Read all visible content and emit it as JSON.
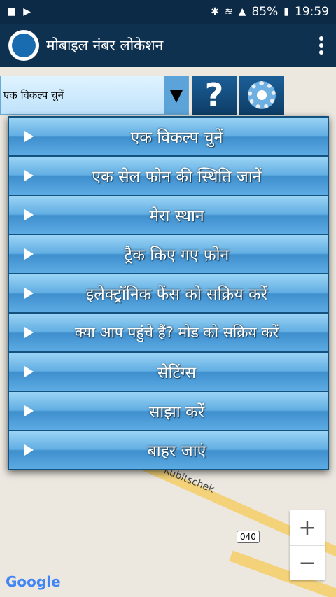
{
  "status": {
    "battery": "85%",
    "time": "19:59"
  },
  "app": {
    "title": "मोबाइल नंबर लोकेशन"
  },
  "toolbar": {
    "select_value": "एक विकल्प चुनें",
    "help_glyph": "?"
  },
  "menu": {
    "items": [
      {
        "label": "एक विकल्प चुनें"
      },
      {
        "label": "एक सेल फोन की स्थिति जानें"
      },
      {
        "label": "मेरा स्थान"
      },
      {
        "label": "ट्रैक किए गए फ़ोन"
      },
      {
        "label": "इलेक्ट्रॉनिक फेंस को सक्रिय करें"
      },
      {
        "label": "क्या आप पहुंचे हैं? मोड को सक्रिय करें"
      },
      {
        "label": "सेटिंग्स"
      },
      {
        "label": "साझा करें"
      },
      {
        "label": "बाहर जाएं"
      }
    ]
  },
  "map": {
    "street_label": "Kubitschek",
    "route_shield": "040",
    "attribution": "Google",
    "zoom_in": "+",
    "zoom_out": "−"
  }
}
